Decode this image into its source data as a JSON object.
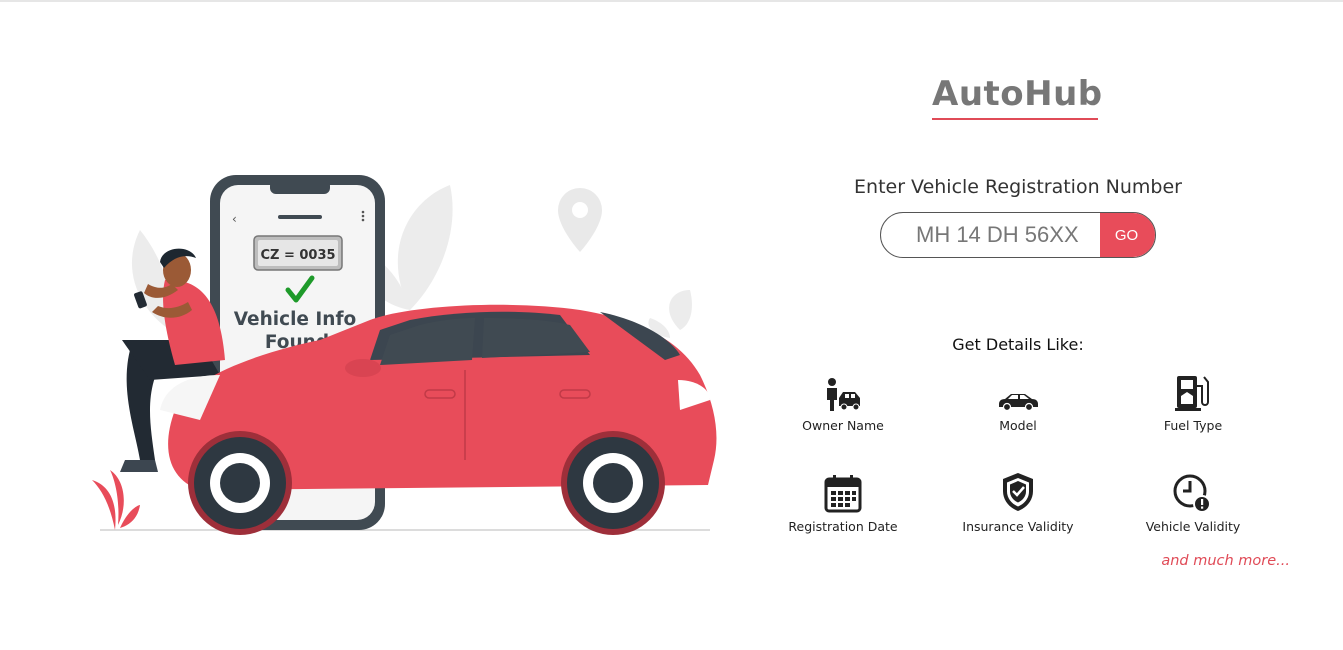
{
  "brand": {
    "title": "AutoHub",
    "accent": "#e04b57"
  },
  "illustration": {
    "plate_text": "CZ = 0035",
    "phone_message_line1": "Vehicle Info",
    "phone_message_line2": "Found"
  },
  "search": {
    "prompt": "Enter Vehicle Registration Number",
    "placeholder": "MH 14 DH 56XX",
    "value": "",
    "go_label": "GO",
    "button_color": "#e84c5a"
  },
  "details": {
    "title": "Get Details Like:",
    "features": [
      {
        "label": "Owner Name",
        "icon": "owner-car-icon"
      },
      {
        "label": "Model",
        "icon": "car-icon"
      },
      {
        "label": "Fuel Type",
        "icon": "fuel-pump-icon"
      },
      {
        "label": "Registration Date",
        "icon": "calendar-icon"
      },
      {
        "label": "Insurance Validity",
        "icon": "shield-check-icon"
      },
      {
        "label": "Vehicle Validity",
        "icon": "clock-alert-icon"
      }
    ],
    "more_text": "and much more..."
  }
}
